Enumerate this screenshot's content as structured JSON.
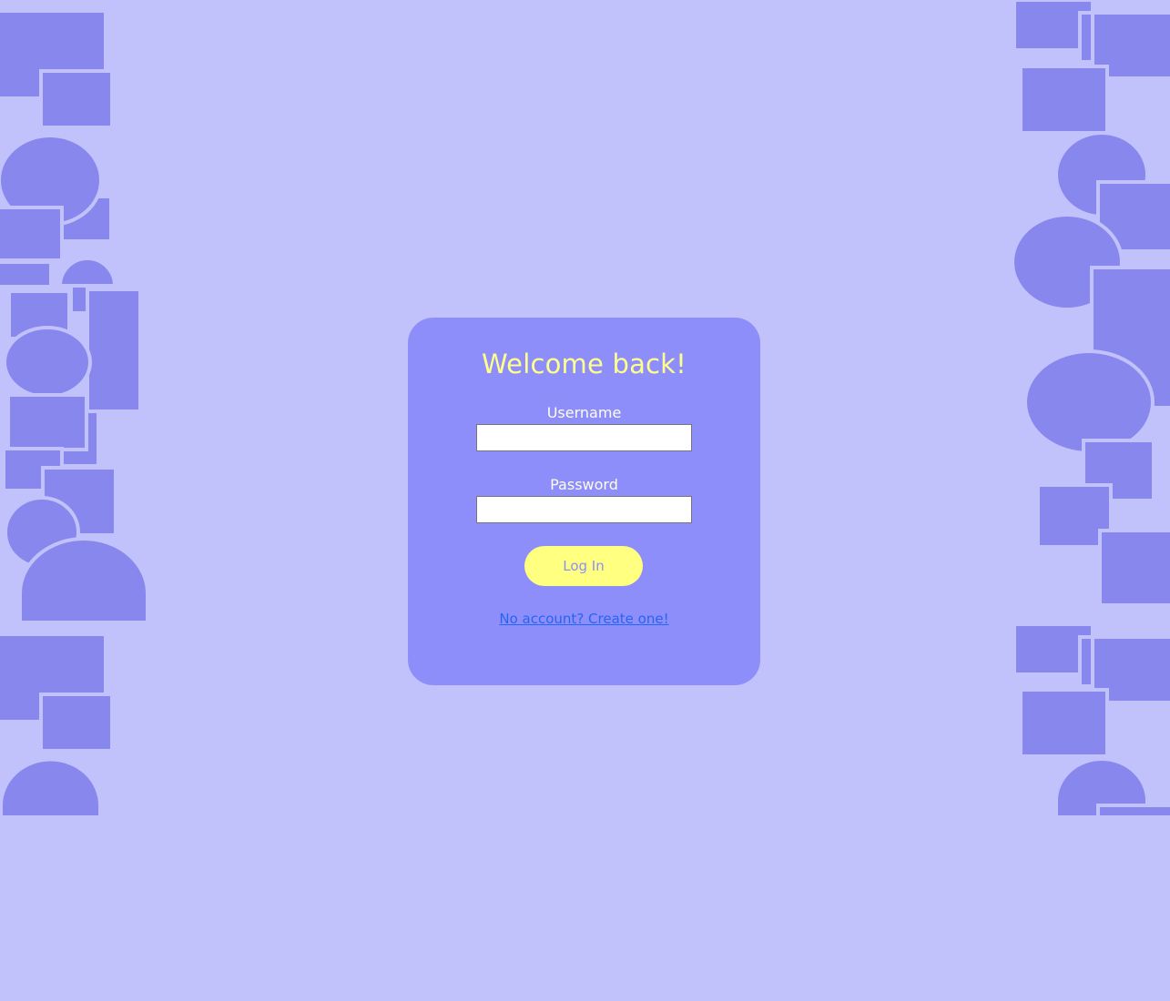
{
  "login": {
    "title": "Welcome back!",
    "username_label": "Username",
    "username_value": "",
    "password_label": "Password",
    "password_value": "",
    "submit_label": "Log In",
    "signup_link": "No account? Create one!"
  },
  "colors": {
    "page_background": "#c1c1fb",
    "card_background": "#8e8efb",
    "decor_shapes": "#8787ee",
    "title_text": "#ffff8c",
    "button_background": "#ffff80",
    "link_text": "#2565f3"
  }
}
